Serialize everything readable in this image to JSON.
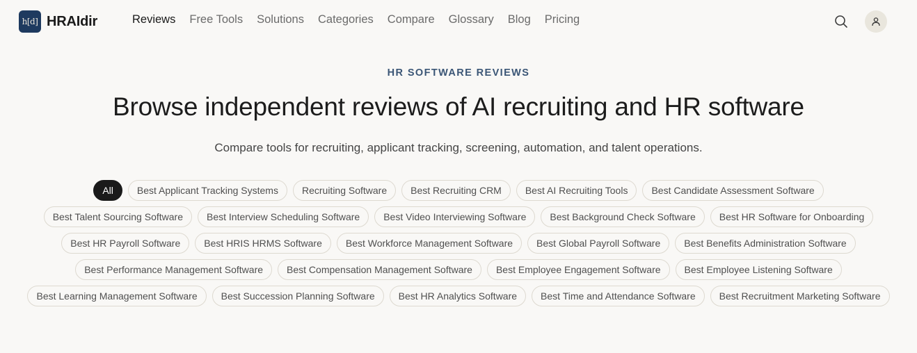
{
  "header": {
    "logo_mark": "h[d]",
    "brand": "HRAIdir",
    "nav": [
      {
        "label": "Reviews",
        "active": true
      },
      {
        "label": "Free Tools",
        "active": false
      },
      {
        "label": "Solutions",
        "active": false
      },
      {
        "label": "Categories",
        "active": false
      },
      {
        "label": "Compare",
        "active": false
      },
      {
        "label": "Glossary",
        "active": false
      },
      {
        "label": "Blog",
        "active": false
      },
      {
        "label": "Pricing",
        "active": false
      }
    ]
  },
  "hero": {
    "eyebrow": "HR SOFTWARE REVIEWS",
    "title": "Browse independent reviews of AI recruiting and HR software",
    "subtitle": "Compare tools for recruiting, applicant tracking, screening, automation, and talent operations."
  },
  "filters": [
    "All",
    "Best Applicant Tracking Systems",
    "Recruiting Software",
    "Best Recruiting CRM",
    "Best AI Recruiting Tools",
    "Best Candidate Assessment Software",
    "Best Talent Sourcing Software",
    "Best Interview Scheduling Software",
    "Best Video Interviewing Software",
    "Best Background Check Software",
    "Best HR Software for Onboarding",
    "Best HR Payroll Software",
    "Best HRIS HRMS Software",
    "Best Workforce Management Software",
    "Best Global Payroll Software",
    "Best Benefits Administration Software",
    "Best Performance Management Software",
    "Best Compensation Management Software",
    "Best Employee Engagement Software",
    "Best Employee Listening Software",
    "Best Learning Management Software",
    "Best Succession Planning Software",
    "Best HR Analytics Software",
    "Best Time and Attendance Software",
    "Best Recruitment Marketing Software"
  ],
  "active_filter": "All",
  "icons": {
    "search": "search-icon",
    "account": "user-icon"
  },
  "colors": {
    "background": "#f9f8f6",
    "accent": "#3b5676",
    "logo_bg": "#1e3a5f"
  }
}
